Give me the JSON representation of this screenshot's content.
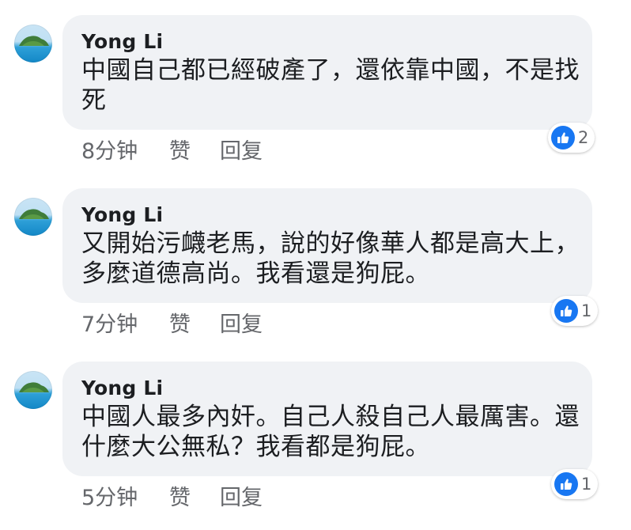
{
  "colors": {
    "bubble": "#f0f2f5",
    "meta_text": "#65676b",
    "like_blue": "#1877f2"
  },
  "comments": [
    {
      "author": "Yong Li",
      "text": "中國自己都已經破產了，還依靠中國，不是找死",
      "time": "8分钟",
      "like_label": "赞",
      "reply_label": "回复",
      "reaction_icon": "thumbs-up-icon",
      "reaction_count": "2"
    },
    {
      "author": "Yong Li",
      "text": "又開始污衊老馬，說的好像華人都是高大上，多麼道德高尚。我看還是狗屁。",
      "time": "7分钟",
      "like_label": "赞",
      "reply_label": "回复",
      "reaction_icon": "thumbs-up-icon",
      "reaction_count": "1"
    },
    {
      "author": "Yong Li",
      "text": "中國人最多內奸。自己人殺自己人最厲害。還什麼大公無私？我看都是狗屁。",
      "time": "5分钟",
      "like_label": "赞",
      "reply_label": "回复",
      "reaction_icon": "thumbs-up-icon",
      "reaction_count": "1"
    }
  ]
}
